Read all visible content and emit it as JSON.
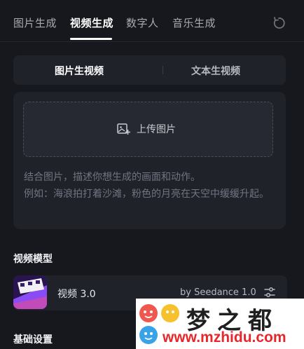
{
  "tabs": [
    {
      "label": "图片生成"
    },
    {
      "label": "视频生成"
    },
    {
      "label": "数字人"
    },
    {
      "label": "音乐生成"
    }
  ],
  "active_tab": "视频生成",
  "mode_switch": {
    "options": [
      {
        "label": "图片生视频"
      },
      {
        "label": "文本生视频"
      }
    ],
    "active": "图片生视频"
  },
  "prompt_card": {
    "upload_label": "上传图片",
    "placeholder": "结合图片，描述你想生成的画面和动作。\n例如：海浪拍打着沙滩，粉色的月亮在天空中缓缓升起。"
  },
  "model_section": {
    "title": "视频模型",
    "model_name": "视频 3.0",
    "provider": "by Seedance 1.0"
  },
  "basic_settings": {
    "title": "基础设置"
  },
  "watermark": {
    "title": "梦之都",
    "url": "www.mzhidu.com"
  },
  "colors": {
    "background": "#17181e",
    "card": "#20222a",
    "accent_watermark": "#e8262b"
  }
}
